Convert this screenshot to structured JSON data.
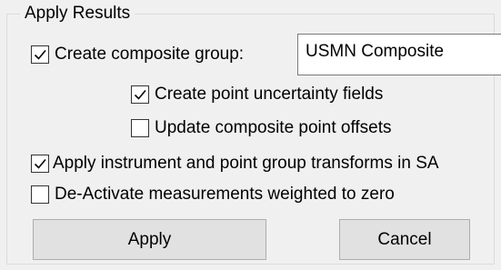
{
  "group": {
    "title": "Apply Results"
  },
  "options": {
    "create_composite": {
      "label": "Create composite group:",
      "checked": true
    },
    "composite_name": {
      "value": "USMN Composite"
    },
    "create_uncertainty": {
      "label": "Create point uncertainty fields",
      "checked": true
    },
    "update_offsets": {
      "label": "Update composite point offsets",
      "checked": false
    },
    "apply_transforms": {
      "label": "Apply instrument and point group transforms in SA",
      "checked": true
    },
    "deactivate_zero": {
      "label": "De-Activate measurements weighted to zero",
      "checked": false
    }
  },
  "buttons": {
    "apply_label": "Apply",
    "cancel_label": "Cancel"
  },
  "colors": {
    "background": "#f0f0f0",
    "button_face": "#e1e1e1",
    "border": "#adadad"
  }
}
